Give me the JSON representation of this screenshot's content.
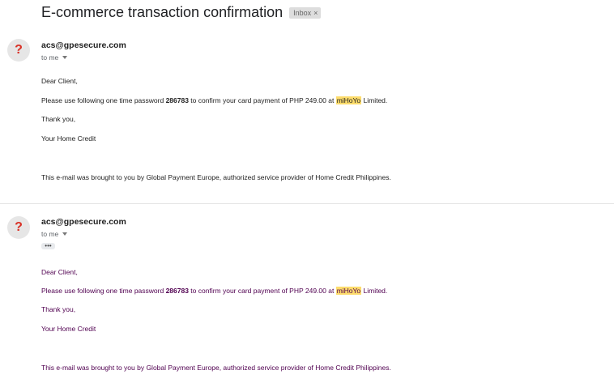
{
  "subject": "E-commerce transaction confirmation",
  "label": "Inbox",
  "label_close": "×",
  "messages": [
    {
      "sender": "acs@gpesecure.com",
      "recipient": "to me",
      "greeting": "Dear Client,",
      "line_pre": "Please use following one time password ",
      "otp": "286783",
      "line_mid": " to confirm your card payment of PHP 249.00 at ",
      "merchant": "miHoYo",
      "line_post": " Limited.",
      "thanks": "Thank you,",
      "signature": "Your Home Credit",
      "footer": "This e-mail was brought to you by Global Payment Europe, authorized service provider of Home Credit Philippines."
    },
    {
      "sender": "acs@gpesecure.com",
      "recipient": "to me",
      "ellipsis": "•••",
      "greeting": "Dear Client,",
      "line_pre": "Please use following one time password ",
      "otp": "286783",
      "line_mid": " to confirm your card payment of PHP 249.00 at ",
      "merchant": "miHoYo",
      "line_post": " Limited.",
      "thanks": "Thank you,",
      "signature": "Your Home Credit",
      "footer": "This e-mail was brought to you by Global Payment Europe, authorized service provider of Home Credit Philippines."
    }
  ],
  "avatar_glyph": "?",
  "colors": {
    "highlight": "#fddc6c",
    "quoted_text": "#500050",
    "avatar_glyph": "#d93025"
  }
}
